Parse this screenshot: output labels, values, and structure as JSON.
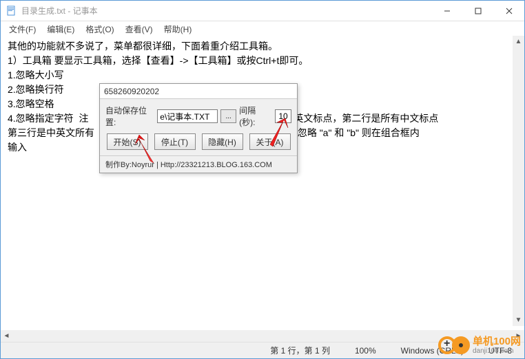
{
  "window": {
    "title": "目录生成.txt - 记事本"
  },
  "menu": {
    "file": "文件(F)",
    "edit": "编辑(E)",
    "format": "格式(O)",
    "view": "查看(V)",
    "help": "帮助(H)"
  },
  "content": {
    "l1": "其他的功能就不多说了，菜单都很详细，下面着重介绍工具箱。",
    "l2": "1）工具箱 要显示工具箱，选择【查看】->【工具箱】或按Ctrl+t即可。",
    "l3": "1.忽略大小写",
    "l4": "2.忽略换行符",
    "l5": "3.忽略空格",
    "l6": "4.忽略指定字符  注                                                                        f有英文标点，第二行是所有中文标点",
    "l7": "第三行是中英文所有                                                              ,  比如要忽略 \"a\" 和 \"b\" 则在组合框内",
    "l8": "输入"
  },
  "dialog": {
    "title": "658260920202",
    "savepos_label": "自动保存位置:",
    "savepos_value": "e\\记事本.TXT",
    "browse": "...",
    "interval_label": "间隔 (秒):",
    "interval_value": "10",
    "btn_start": "开始(S)",
    "btn_stop": "停止(T)",
    "btn_hide": "隐藏(H)",
    "btn_about": "关于(A)",
    "footer": "制作By:Noyrur | Http://23321213.BLOG.163.COM"
  },
  "statusbar": {
    "pos": "第 1 行，第 1 列",
    "zoom": "100%",
    "encoding": "Windows (CRLF)",
    "utf": "UTF-8"
  },
  "watermark": {
    "name": "单机100网",
    "url": "danji100.com"
  }
}
